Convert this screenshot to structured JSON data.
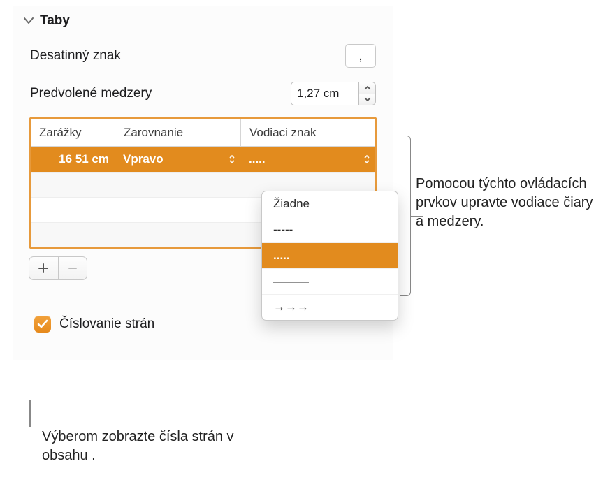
{
  "section": {
    "title": "Taby"
  },
  "decimal": {
    "label": "Desatinný znak",
    "value": ","
  },
  "spacing": {
    "label": "Predvolené medzery",
    "value": "1,27 cm"
  },
  "table": {
    "headers": {
      "stops": "Zarážky",
      "align": "Zarovnanie",
      "leader": "Vodiaci znak"
    },
    "row": {
      "stop": "16 51 cm",
      "align": "Vpravo",
      "leader": "....."
    }
  },
  "leader_menu": {
    "none": "Žiadne",
    "dashes": "-----",
    "dots": ".....",
    "line": "———",
    "arrows": "→→→"
  },
  "pagenum": {
    "label": "Číslovanie strán",
    "checked": true
  },
  "callouts": {
    "right": "Pomocou týchto ovládacích prvkov upravte vodiace čiary a medzery.",
    "bottom": "Výberom zobrazte čísla strán v obsahu ."
  }
}
